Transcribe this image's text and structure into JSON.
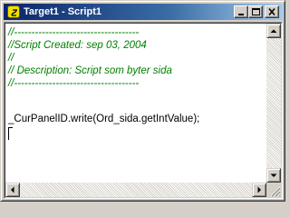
{
  "window": {
    "title": "Target1 - Script1",
    "app_icon": "script-app-icon",
    "buttons": {
      "minimize": "minimize-icon",
      "maximize": "maximize-icon",
      "close": "close-icon"
    }
  },
  "editor": {
    "lines": [
      "//------------------------------------",
      "//Script Created: sep 03, 2004",
      "//",
      "// Description: Script som byter sida",
      "//------------------------------------",
      "",
      "_CurPanelID.write(Ord_sida.getIntValue);"
    ],
    "colors": {
      "comment": "#008000",
      "code": "#000000",
      "background": "#ffffff"
    }
  },
  "scrollbars": {
    "vertical": {
      "up": "arrow-up-icon",
      "down": "arrow-down-icon"
    },
    "horizontal": {
      "left": "arrow-left-icon",
      "right": "arrow-right-icon"
    },
    "grip": "size-grip-icon"
  },
  "theme": {
    "titlebar_start": "#0a246a",
    "titlebar_end": "#a6caf0",
    "face": "#d4d0c8"
  }
}
